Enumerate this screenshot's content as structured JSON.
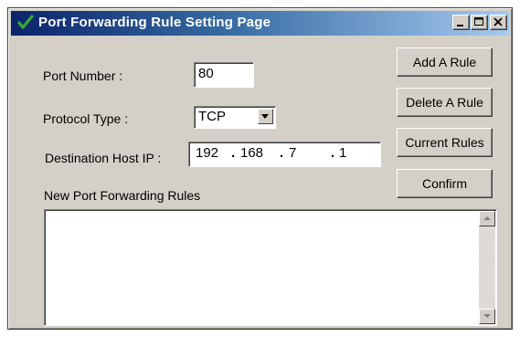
{
  "window": {
    "title": "Port Forwarding Rule Setting Page",
    "title_icon": "check-icon",
    "controls": [
      "minimize-icon",
      "maximize-icon",
      "close-icon"
    ]
  },
  "form": {
    "port_number": {
      "label": "Port Number :",
      "value": "80"
    },
    "protocol_type": {
      "label": "Protocol Type :",
      "value": "TCP"
    },
    "destination_host_ip": {
      "label": "Destination Host IP :",
      "octets": [
        "192",
        "168",
        "7",
        "1"
      ]
    },
    "rules_label": "New Port Forwarding Rules"
  },
  "buttons": {
    "add_rule": "Add A Rule",
    "delete_rule": "Delete A Rule",
    "current_rules": "Current Rules",
    "confirm": "Confirm"
  },
  "colors": {
    "titlebar_start": "#0a246a",
    "titlebar_end": "#a6caf0",
    "window_bg": "#d4d0c8",
    "check_icon": "#3aa836"
  }
}
